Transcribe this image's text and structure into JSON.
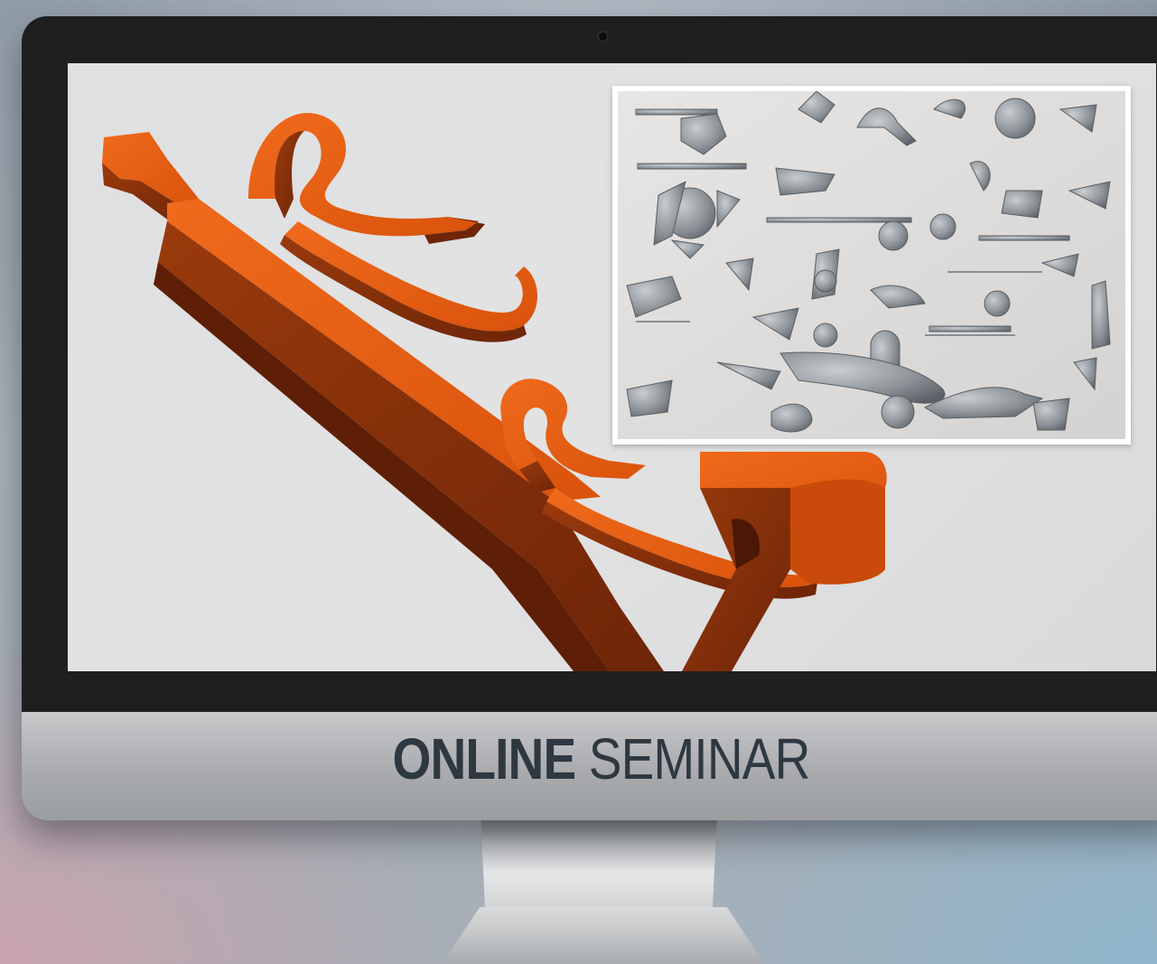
{
  "banner": {
    "word_bold": "ONLINE",
    "word_regular": "SEMINAR"
  },
  "colors": {
    "cad_orange": "#e05a10",
    "cad_shadow": "#7a2a0a",
    "label_dark": "#2e3841",
    "screen_bg": "#e0e1e2"
  },
  "icons": {
    "camera": "webcam-dot"
  }
}
